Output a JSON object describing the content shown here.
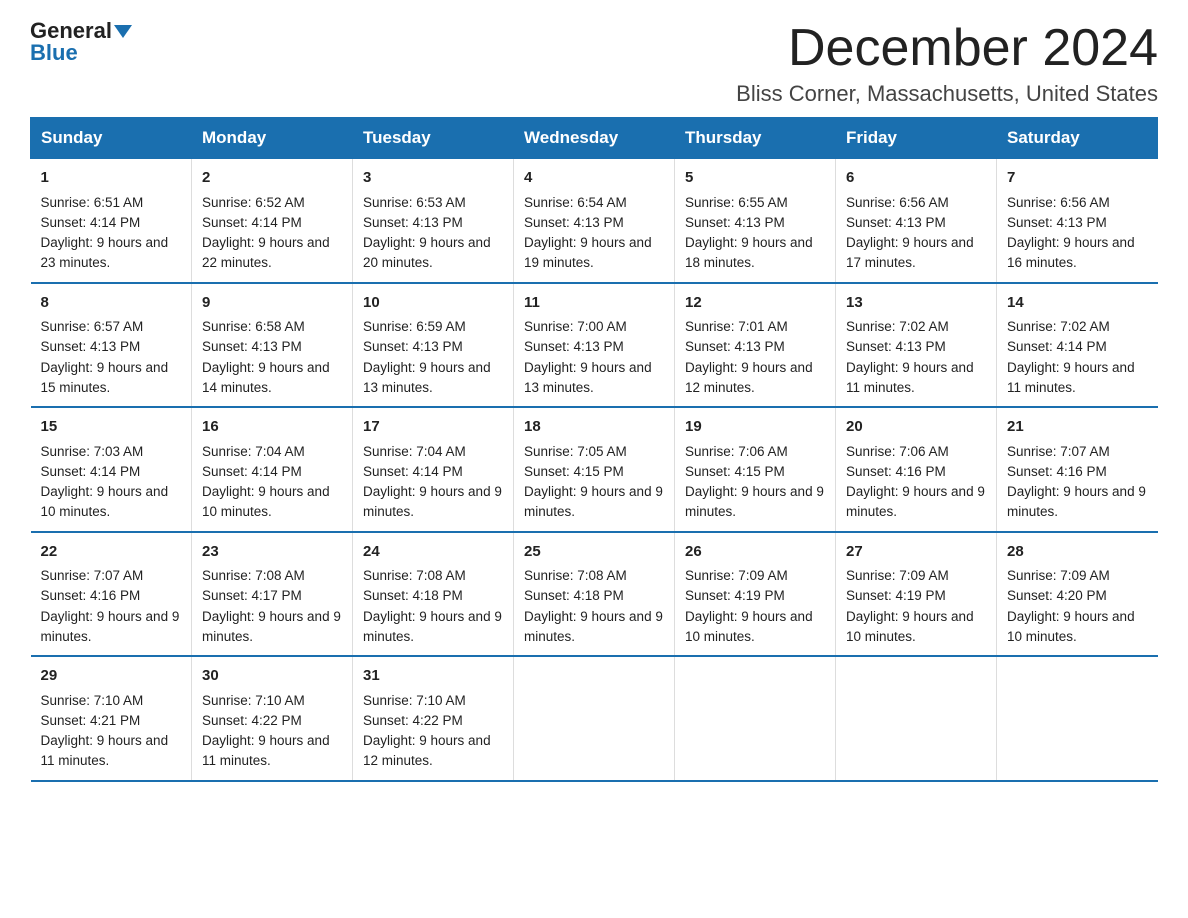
{
  "logo": {
    "general": "General",
    "blue": "Blue"
  },
  "title": "December 2024",
  "location": "Bliss Corner, Massachusetts, United States",
  "days_of_week": [
    "Sunday",
    "Monday",
    "Tuesday",
    "Wednesday",
    "Thursday",
    "Friday",
    "Saturday"
  ],
  "weeks": [
    [
      {
        "day": "1",
        "sunrise": "6:51 AM",
        "sunset": "4:14 PM",
        "daylight": "9 hours and 23 minutes."
      },
      {
        "day": "2",
        "sunrise": "6:52 AM",
        "sunset": "4:14 PM",
        "daylight": "9 hours and 22 minutes."
      },
      {
        "day": "3",
        "sunrise": "6:53 AM",
        "sunset": "4:13 PM",
        "daylight": "9 hours and 20 minutes."
      },
      {
        "day": "4",
        "sunrise": "6:54 AM",
        "sunset": "4:13 PM",
        "daylight": "9 hours and 19 minutes."
      },
      {
        "day": "5",
        "sunrise": "6:55 AM",
        "sunset": "4:13 PM",
        "daylight": "9 hours and 18 minutes."
      },
      {
        "day": "6",
        "sunrise": "6:56 AM",
        "sunset": "4:13 PM",
        "daylight": "9 hours and 17 minutes."
      },
      {
        "day": "7",
        "sunrise": "6:56 AM",
        "sunset": "4:13 PM",
        "daylight": "9 hours and 16 minutes."
      }
    ],
    [
      {
        "day": "8",
        "sunrise": "6:57 AM",
        "sunset": "4:13 PM",
        "daylight": "9 hours and 15 minutes."
      },
      {
        "day": "9",
        "sunrise": "6:58 AM",
        "sunset": "4:13 PM",
        "daylight": "9 hours and 14 minutes."
      },
      {
        "day": "10",
        "sunrise": "6:59 AM",
        "sunset": "4:13 PM",
        "daylight": "9 hours and 13 minutes."
      },
      {
        "day": "11",
        "sunrise": "7:00 AM",
        "sunset": "4:13 PM",
        "daylight": "9 hours and 13 minutes."
      },
      {
        "day": "12",
        "sunrise": "7:01 AM",
        "sunset": "4:13 PM",
        "daylight": "9 hours and 12 minutes."
      },
      {
        "day": "13",
        "sunrise": "7:02 AM",
        "sunset": "4:13 PM",
        "daylight": "9 hours and 11 minutes."
      },
      {
        "day": "14",
        "sunrise": "7:02 AM",
        "sunset": "4:14 PM",
        "daylight": "9 hours and 11 minutes."
      }
    ],
    [
      {
        "day": "15",
        "sunrise": "7:03 AM",
        "sunset": "4:14 PM",
        "daylight": "9 hours and 10 minutes."
      },
      {
        "day": "16",
        "sunrise": "7:04 AM",
        "sunset": "4:14 PM",
        "daylight": "9 hours and 10 minutes."
      },
      {
        "day": "17",
        "sunrise": "7:04 AM",
        "sunset": "4:14 PM",
        "daylight": "9 hours and 9 minutes."
      },
      {
        "day": "18",
        "sunrise": "7:05 AM",
        "sunset": "4:15 PM",
        "daylight": "9 hours and 9 minutes."
      },
      {
        "day": "19",
        "sunrise": "7:06 AM",
        "sunset": "4:15 PM",
        "daylight": "9 hours and 9 minutes."
      },
      {
        "day": "20",
        "sunrise": "7:06 AM",
        "sunset": "4:16 PM",
        "daylight": "9 hours and 9 minutes."
      },
      {
        "day": "21",
        "sunrise": "7:07 AM",
        "sunset": "4:16 PM",
        "daylight": "9 hours and 9 minutes."
      }
    ],
    [
      {
        "day": "22",
        "sunrise": "7:07 AM",
        "sunset": "4:16 PM",
        "daylight": "9 hours and 9 minutes."
      },
      {
        "day": "23",
        "sunrise": "7:08 AM",
        "sunset": "4:17 PM",
        "daylight": "9 hours and 9 minutes."
      },
      {
        "day": "24",
        "sunrise": "7:08 AM",
        "sunset": "4:18 PM",
        "daylight": "9 hours and 9 minutes."
      },
      {
        "day": "25",
        "sunrise": "7:08 AM",
        "sunset": "4:18 PM",
        "daylight": "9 hours and 9 minutes."
      },
      {
        "day": "26",
        "sunrise": "7:09 AM",
        "sunset": "4:19 PM",
        "daylight": "9 hours and 10 minutes."
      },
      {
        "day": "27",
        "sunrise": "7:09 AM",
        "sunset": "4:19 PM",
        "daylight": "9 hours and 10 minutes."
      },
      {
        "day": "28",
        "sunrise": "7:09 AM",
        "sunset": "4:20 PM",
        "daylight": "9 hours and 10 minutes."
      }
    ],
    [
      {
        "day": "29",
        "sunrise": "7:10 AM",
        "sunset": "4:21 PM",
        "daylight": "9 hours and 11 minutes."
      },
      {
        "day": "30",
        "sunrise": "7:10 AM",
        "sunset": "4:22 PM",
        "daylight": "9 hours and 11 minutes."
      },
      {
        "day": "31",
        "sunrise": "7:10 AM",
        "sunset": "4:22 PM",
        "daylight": "9 hours and 12 minutes."
      },
      null,
      null,
      null,
      null
    ]
  ],
  "labels": {
    "sunrise": "Sunrise:",
    "sunset": "Sunset:",
    "daylight": "Daylight:"
  }
}
